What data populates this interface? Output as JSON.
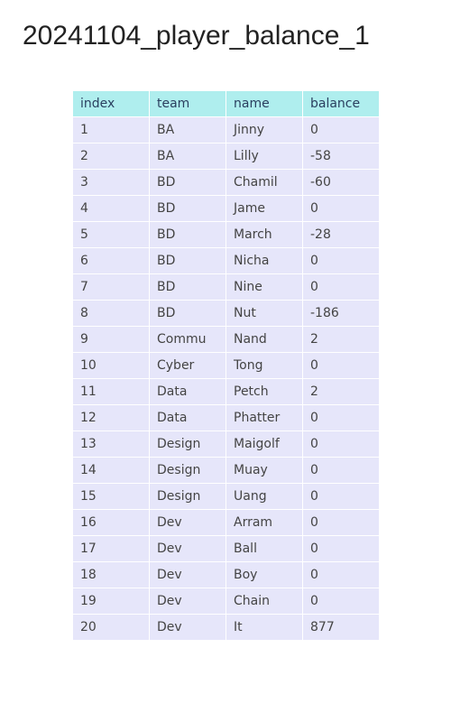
{
  "chart_data": {
    "type": "table",
    "title": "20241104_player_balance_1",
    "columns": [
      "index",
      "team",
      "name",
      "balance"
    ],
    "rows": [
      [
        "1",
        "BA",
        "Jinny",
        "0"
      ],
      [
        "2",
        "BA",
        "Lilly",
        "-58"
      ],
      [
        "3",
        "BD",
        "Chamil",
        "-60"
      ],
      [
        "4",
        "BD",
        "Jame",
        "0"
      ],
      [
        "5",
        "BD",
        "March",
        "-28"
      ],
      [
        "6",
        "BD",
        "Nicha",
        "0"
      ],
      [
        "7",
        "BD",
        "Nine",
        "0"
      ],
      [
        "8",
        "BD",
        "Nut",
        "-186"
      ],
      [
        "9",
        "Commu",
        "Nand",
        "2"
      ],
      [
        "10",
        "Cyber",
        "Tong",
        "0"
      ],
      [
        "11",
        "Data",
        "Petch",
        "2"
      ],
      [
        "12",
        "Data",
        "Phatter",
        "0"
      ],
      [
        "13",
        "Design",
        "Maigolf",
        "0"
      ],
      [
        "14",
        "Design",
        "Muay",
        "0"
      ],
      [
        "15",
        "Design",
        "Uang",
        "0"
      ],
      [
        "16",
        "Dev",
        "Arram",
        "0"
      ],
      [
        "17",
        "Dev",
        "Ball",
        "0"
      ],
      [
        "18",
        "Dev",
        "Boy",
        "0"
      ],
      [
        "19",
        "Dev",
        "Chain",
        "0"
      ],
      [
        "20",
        "Dev",
        "It",
        "877"
      ]
    ],
    "header_fill": "#afeeee",
    "cell_fill": "#e6e6fa",
    "header_text_color": "#2a3f5f",
    "cell_text_color": "#444444"
  }
}
